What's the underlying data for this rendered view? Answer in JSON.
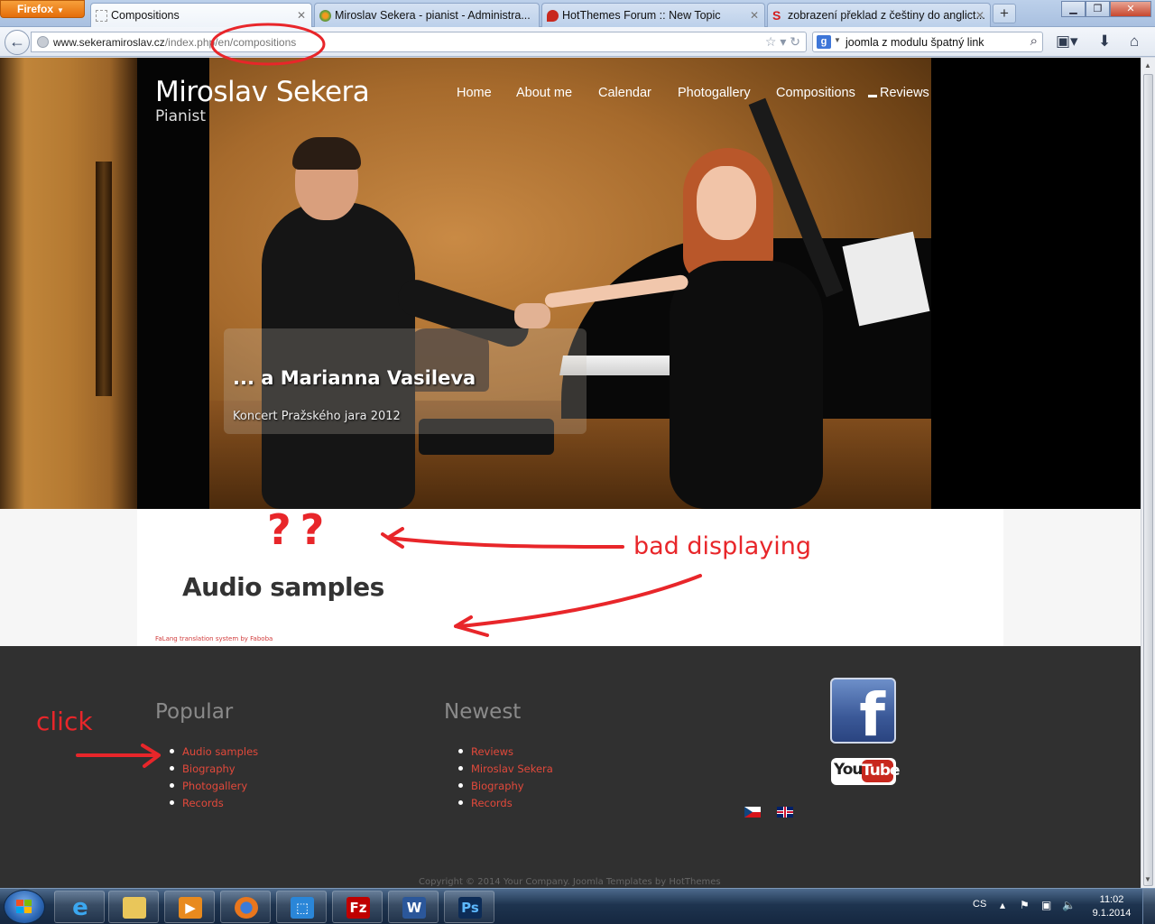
{
  "browser": {
    "menu_button": "Firefox",
    "tabs": [
      {
        "title": "Compositions",
        "active": true
      },
      {
        "title": "Miroslav Sekera - pianist - Administra...",
        "active": false
      },
      {
        "title": "HotThemes Forum :: New Topic",
        "active": false
      },
      {
        "title": "zobrazení překlad z češtiny do anglict...",
        "active": false
      }
    ],
    "new_tab": "+",
    "url_host": "www.sekeramiroslav.cz",
    "url_path": "/index.php/en/compositions",
    "search_query": "joomla z modulu špatný link",
    "search_engine_icon": "google-icon"
  },
  "site": {
    "title": "Miroslav Sekera",
    "subtitle": "Pianist",
    "nav": [
      "Home",
      "About me",
      "Calendar",
      "Photogallery",
      "Compositions",
      "Reviews"
    ],
    "slide_caption_title": "... a Marianna Vasileva",
    "slide_caption_subtitle": "Koncert Pražského jara 2012",
    "content_heading": "Audio samples",
    "falang_credit": "FaLang translation system by Faboba",
    "footer": {
      "popular_heading": "Popular",
      "popular_items": [
        "Audio samples",
        "Biography",
        "Photogallery",
        "Records"
      ],
      "newest_heading": "Newest",
      "newest_items": [
        "Reviews",
        "Miroslav Sekera",
        "Biography",
        "Records"
      ],
      "copyright": "Copyright © 2014 Your Company. Joomla Templates by HotThemes",
      "social": [
        "facebook-icon",
        "youtube-icon"
      ],
      "youtube_you": "You",
      "youtube_tube": "Tube",
      "facebook_letter": "f",
      "languages": [
        "cz-flag-icon",
        "gb-flag-icon"
      ]
    }
  },
  "annotations": {
    "question_marks": "??",
    "bad_displaying": "bad displaying",
    "click": "click"
  },
  "taskbar": {
    "language": "CS",
    "time": "11:02",
    "date": "9.1.2014",
    "apps": [
      "internet-explorer-icon",
      "explorer-icon",
      "media-player-icon",
      "firefox-icon",
      "snipping-tool-icon",
      "filezilla-icon",
      "word-icon",
      "photoshop-icon"
    ]
  },
  "colors": {
    "link_red": "#e2493b",
    "annotation_red": "#e8262a",
    "footer_bg": "#303030"
  }
}
